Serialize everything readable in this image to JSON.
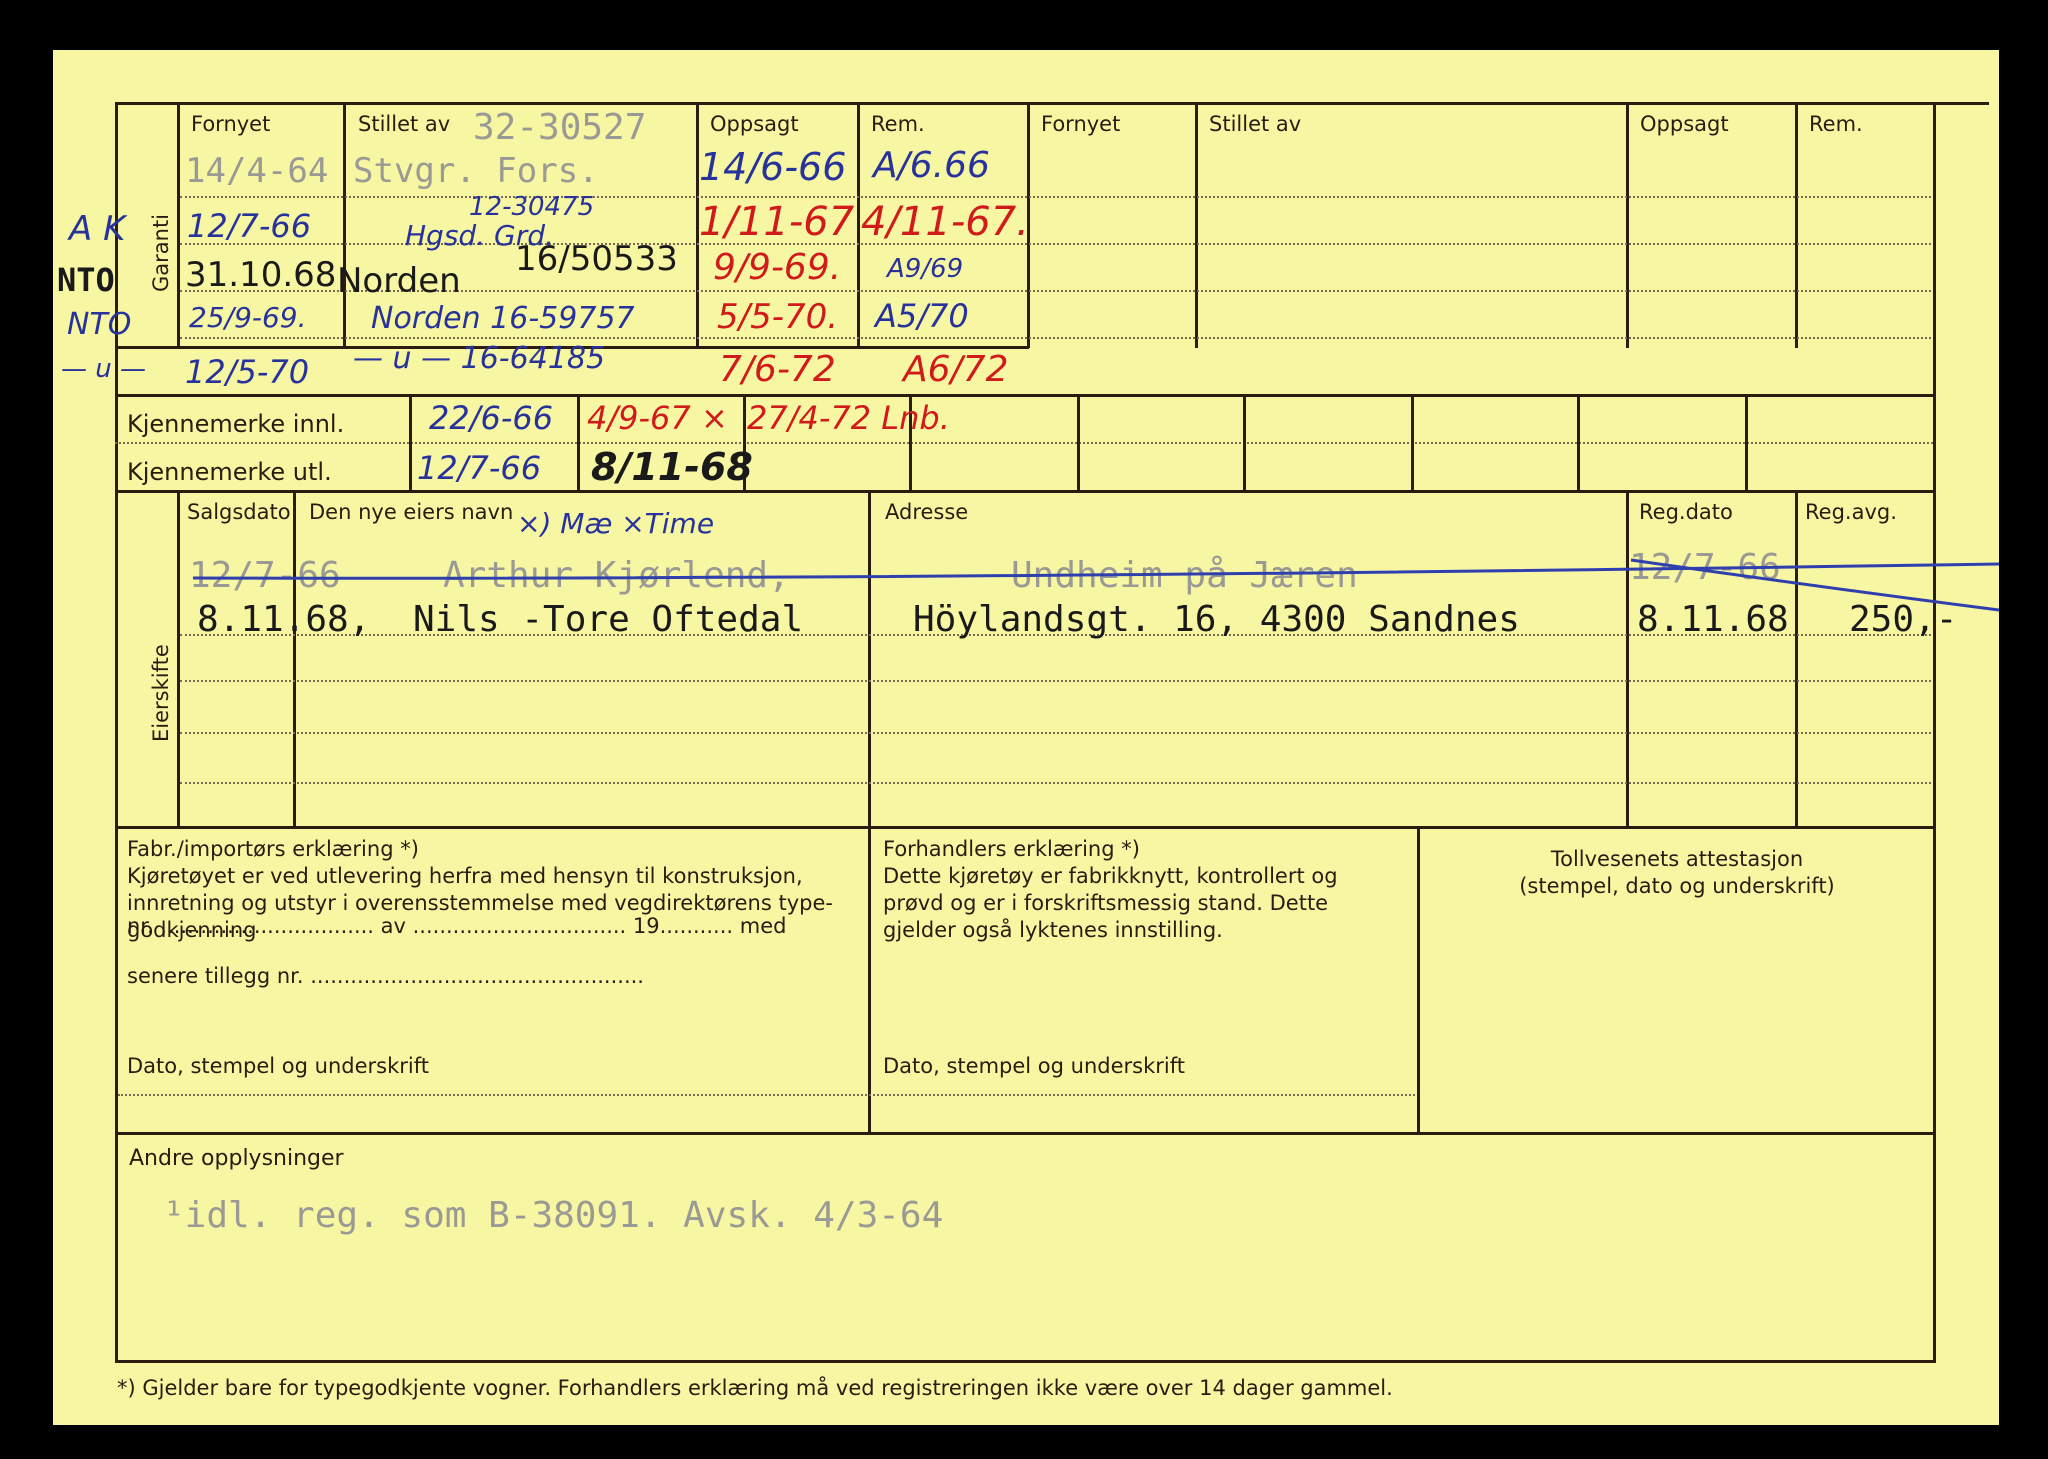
{
  "header": {
    "left": {
      "fornyet": "Fornyet",
      "stillet_av": "Stillet av",
      "oppsagt": "Oppsagt",
      "rem": "Rem."
    },
    "right": {
      "fornyet": "Fornyet",
      "stillet_av": "Stillet av",
      "oppsagt": "Oppsagt",
      "rem": "Rem."
    },
    "garanti": "Garanti"
  },
  "margin_notes": [
    "A K",
    "NTO",
    "NTO",
    "— u —"
  ],
  "policy_number_top": "32-30527",
  "guarantees": [
    {
      "fornyet": "14/4-64",
      "stillet_av": "Stvgr. Fors.",
      "oppsagt": "14/6-66",
      "rem": "A/6.66"
    },
    {
      "fornyet": "12/7-66",
      "policy": "12-30475",
      "stillet_av": "Hgsd. Grd.",
      "oppsagt": "1/11-67",
      "rem": "4/11-67."
    },
    {
      "fornyet": "31.10.68",
      "stillet_av": "Norden",
      "policy": "16/50533",
      "oppsagt": "9/9-69.",
      "rem": "A9/69"
    },
    {
      "fornyet": "25/9-69.",
      "stillet_av": "Norden 16-59757",
      "oppsagt": "5/5-70.",
      "rem": "A5/70"
    },
    {
      "fornyet": "12/5-70",
      "stillet_av": "— u — 16-64185",
      "oppsagt": "7/6-72",
      "rem": "A6/72"
    }
  ],
  "plates": {
    "innl_label": "Kjennemerke innl.",
    "utl_label": "Kjennemerke utl.",
    "innl": [
      "22/6-66",
      "4/9-67 ×",
      "27/4-72 Lnb."
    ],
    "utl": [
      "12/7-66",
      "8/11-68"
    ]
  },
  "eierskifte": {
    "side_label": "Eierskifte",
    "headers": {
      "salgsdato": "Salgsdato",
      "navn": "Den nye eiers navn",
      "adresse": "Adresse",
      "reg_dato": "Reg.dato",
      "reg_avg": "Reg.avg."
    },
    "annotation": "×) Mæ ×Time",
    "rows": [
      {
        "salgsdato": "12/7-66",
        "navn": "Arthur Kjørlend,",
        "adresse": "Undheim på Jæren",
        "reg_dato": "12/7-66",
        "reg_avg": ""
      },
      {
        "salgsdato": "8.11.68,",
        "navn": "Nils -Tore Oftedal",
        "adresse": "Höylandsgt. 16, 4300 Sandnes",
        "reg_dato": "8.11.68",
        "reg_avg": "250,-"
      }
    ]
  },
  "declarations": {
    "fabr": {
      "title": "Fabr./importørs erklæring *)",
      "text": "Kjøretøyet er ved utlevering herfra med hensyn til konstruksjon, innretning og utstyr i overensstemmelse med vegdirektørens type­godkjenning",
      "line1": "nr. ................................ av ................................ 19........... med",
      "line2": "senere tillegg nr. ..................................................",
      "sign": "Dato, stempel og underskrift"
    },
    "forhandler": {
      "title": "Forhandlers erklæring *)",
      "text": "Dette kjøretøy er fabrikknytt, kontrollert og prøvd og er i forskriftsmessig stand. Dette gjelder også lyktenes innstilling.",
      "sign": "Dato, stempel og underskrift"
    },
    "toll": {
      "title": "Tollvesenets attestasjon",
      "sub": "(stempel, dato og underskrift)"
    }
  },
  "andre": {
    "label": "Andre opplysninger",
    "text": "¹idl. reg. som B-38091. Avsk. 4/3-64"
  },
  "footnote": "*)  Gjelder bare for typegodkjente vogner.  Forhandlers erklæring må ved registreringen ikke være over 14 dager gammel."
}
